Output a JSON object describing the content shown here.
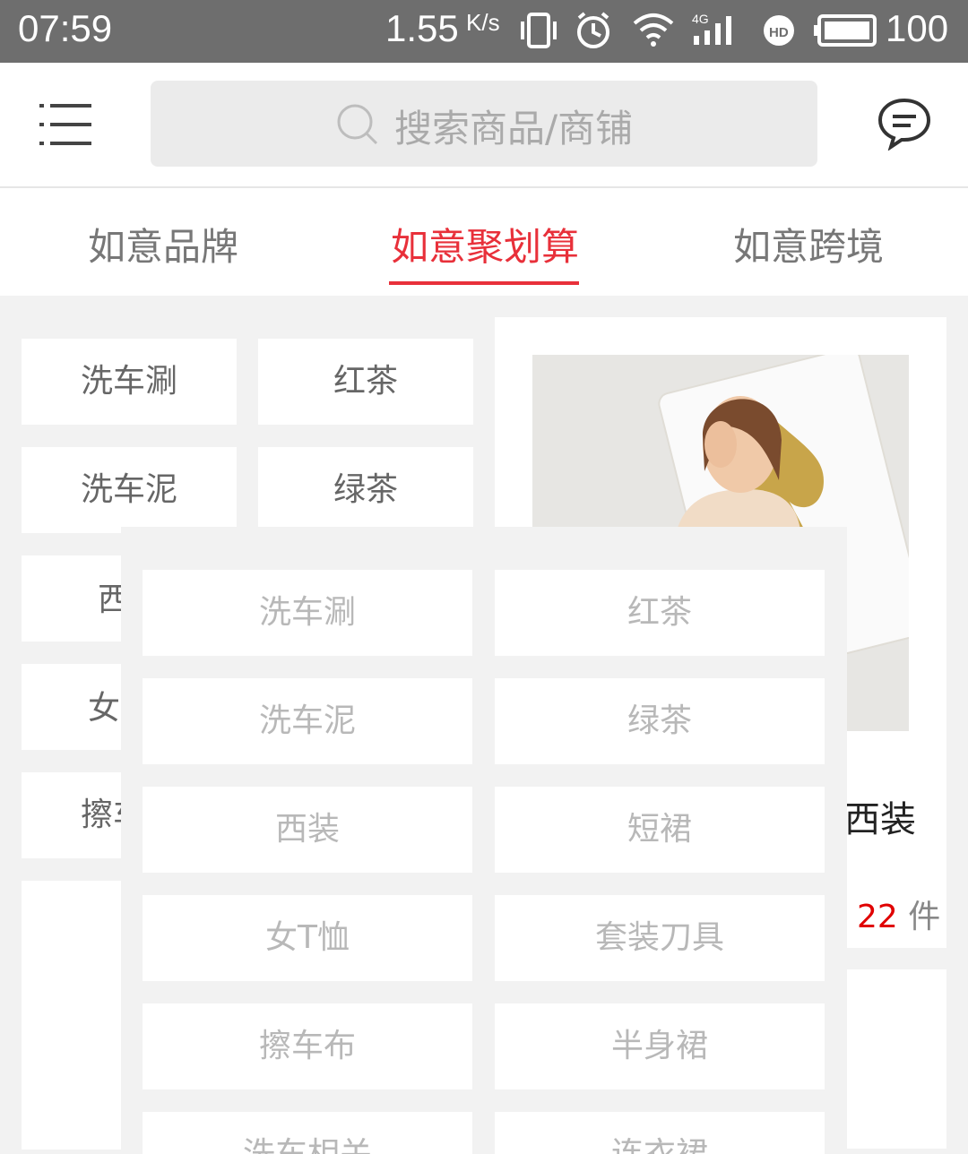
{
  "status_bar": {
    "time": "07:59",
    "net_speed": "1.55",
    "net_speed_unit": "K/s",
    "battery": "100",
    "icons": [
      "vibrate-icon",
      "alarm-icon",
      "wifi-icon",
      "signal-4g-icon",
      "hd-icon",
      "battery-icon"
    ]
  },
  "header": {
    "search_placeholder": "搜索商品/商铺",
    "icons": [
      "menu-icon",
      "search-icon",
      "message-icon"
    ]
  },
  "tabs": [
    {
      "label": "如意品牌",
      "active": false
    },
    {
      "label": "如意聚划算",
      "active": true
    },
    {
      "label": "如意跨境",
      "active": false
    }
  ],
  "background_grid": {
    "left_column": [
      "洗车涮",
      "洗车泥",
      "西",
      "女",
      "擦车"
    ],
    "right_column": [
      "红茶",
      "绿茶"
    ]
  },
  "product": {
    "title_fragment": "西装",
    "count_prefix": "件",
    "count": "22",
    "count_suffix": "件"
  },
  "dropdown": {
    "items": [
      [
        "洗车涮",
        "红茶"
      ],
      [
        "洗车泥",
        "绿茶"
      ],
      [
        "西装",
        "短裙"
      ],
      [
        "女T恤",
        "套装刀具"
      ],
      [
        "擦车布",
        "半身裙"
      ],
      [
        "洗车相关",
        "连衣裙"
      ]
    ]
  },
  "colors": {
    "accent": "#e8303a",
    "price_red": "#e00000",
    "status_bar": "#6e6e6e"
  }
}
